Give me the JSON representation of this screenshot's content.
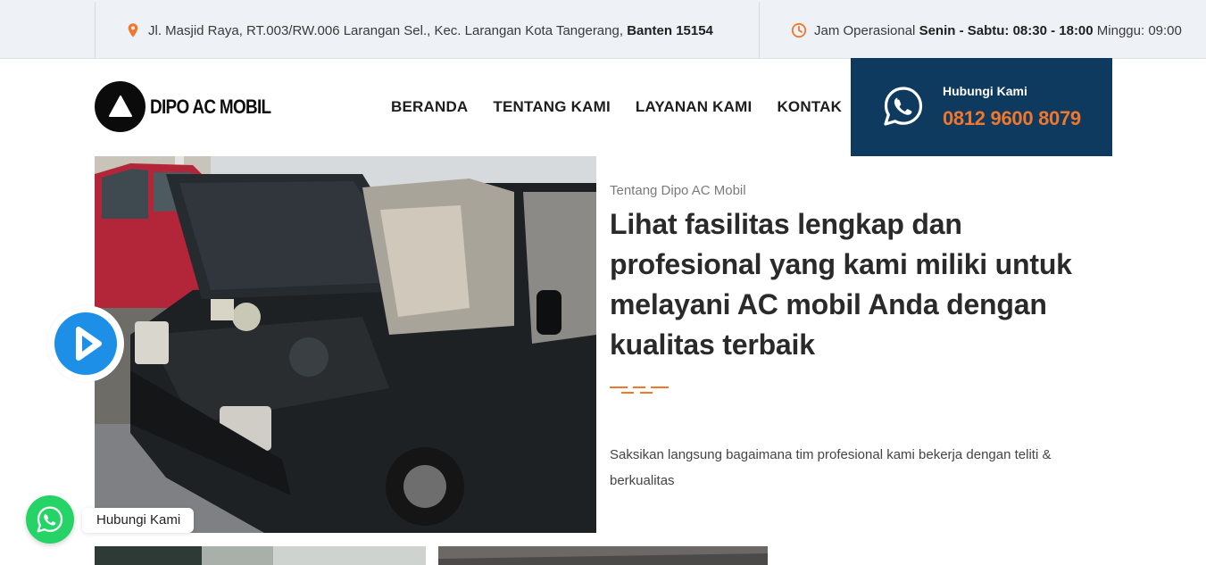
{
  "topbar": {
    "address_prefix": "Jl. Masjid Raya, RT.003/RW.006 Larangan Sel., Kec. Larangan Kota Tangerang,",
    "address_bold": "Banten 15154",
    "hours_prefix": "Jam Operasional",
    "hours_bold": "Senin - Sabtu: 08:30 - 18:00",
    "hours_suffix": "Minggu: 09:00",
    "address_icon": "map-pin-icon",
    "hours_icon": "clock-icon"
  },
  "brand": {
    "name": "DIPO AC MOBIL",
    "logo_icon": "triangle-logo-icon"
  },
  "nav": {
    "items": [
      {
        "label": "BERANDA"
      },
      {
        "label": "TENTANG KAMI"
      },
      {
        "label": "LAYANAN KAMI"
      },
      {
        "label": "KONTAK"
      }
    ]
  },
  "cta": {
    "title": "Hubungi Kami",
    "phone": "0812 9600 8079",
    "icon": "whatsapp-icon"
  },
  "hero": {
    "eyebrow": "Tentang Dipo AC Mobil",
    "headline": "Lihat fasilitas lengkap dan profesional yang kami miliki untuk melayani AC mobil Anda dengan kualitas terbaik",
    "description": "Saksikan langsung bagaimana tim profesional kami bekerja dengan teliti & berkualitas",
    "play_icon": "play-icon"
  },
  "floating": {
    "label": "Hubungi Kami",
    "icon": "whatsapp-icon"
  },
  "colors": {
    "accent_orange": "#f0772b",
    "navy": "#0e3a60",
    "play_blue": "#1e8fe6",
    "whatsapp_green": "#25d366"
  }
}
